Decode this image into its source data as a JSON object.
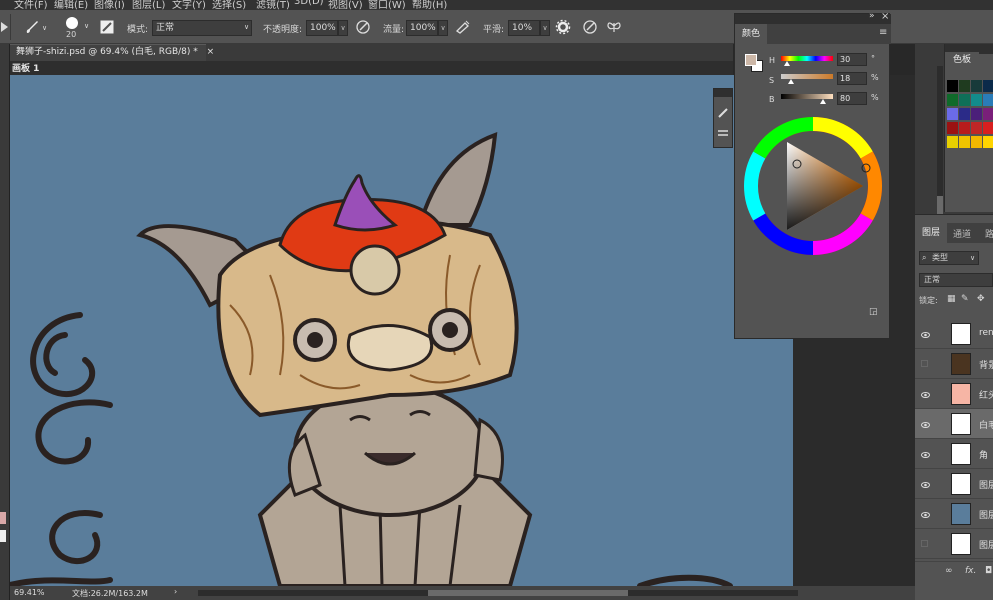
{
  "menu": [
    "文件(F)",
    "编辑(E)",
    "图像(I)",
    "图层(L)",
    "文字(Y)",
    "选择(S)",
    "滤镜(T)",
    "3D(D)",
    "视图(V)",
    "窗口(W)",
    "帮助(H)"
  ],
  "options": {
    "brush_size": "20",
    "mode_label": "模式:",
    "mode_value": "正常",
    "opacity_label": "不透明度:",
    "opacity_value": "100%",
    "flow_label": "流量:",
    "flow_value": "100%",
    "smooth_label": "平滑:",
    "smooth_value": "10%"
  },
  "document": {
    "tab_title": "舞狮子-shizi.psd @ 69.4% (白毛, RGB/8) *",
    "artboard_label": "画板 1"
  },
  "status": {
    "zoom": "69.41%",
    "doc_info": "文档:26.2M/163.2M",
    "arrow": "›"
  },
  "color_panel": {
    "tab": "颜色",
    "menu_glyph": "≡",
    "collapse_glyph": "»",
    "close_glyph": "×",
    "h_label": "H",
    "h_value": "30",
    "h_unit": "°",
    "s_label": "S",
    "s_value": "18",
    "s_unit": "%",
    "b_label": "B",
    "b_value": "80",
    "b_unit": "%",
    "foreground_color": "#ccb7a7",
    "background_color": "#ffffff"
  },
  "swatches": {
    "tab": "色板",
    "colors": [
      "#000000",
      "#1f3b1f",
      "#173a3a",
      "#0b2a4a",
      "#0f6a2a",
      "#0f6f58",
      "#138c8c",
      "#2a7cb8",
      "#6b6be8",
      "#2b2b88",
      "#4b1f7a",
      "#7a1f7a",
      "#9b1212",
      "#b81c1c",
      "#c02626",
      "#d81f1f",
      "#e8d000",
      "#f0c400",
      "#f2b800",
      "#ffd400"
    ]
  },
  "layers_panel": {
    "tabs": [
      "图层",
      "通道",
      "路"
    ],
    "filter_kind": "类型",
    "blend_mode": "正常",
    "lock_label": "锁定:",
    "fx_label": "fx.",
    "layers": [
      {
        "name": "ren",
        "visible": true
      },
      {
        "name": "背景",
        "visible": false
      },
      {
        "name": "红头",
        "visible": true
      },
      {
        "name": "白毛",
        "visible": true,
        "selected": true
      },
      {
        "name": "角",
        "visible": true
      },
      {
        "name": "图层",
        "visible": true
      },
      {
        "name": "图层",
        "visible": true
      },
      {
        "name": "图层",
        "visible": false
      }
    ]
  }
}
